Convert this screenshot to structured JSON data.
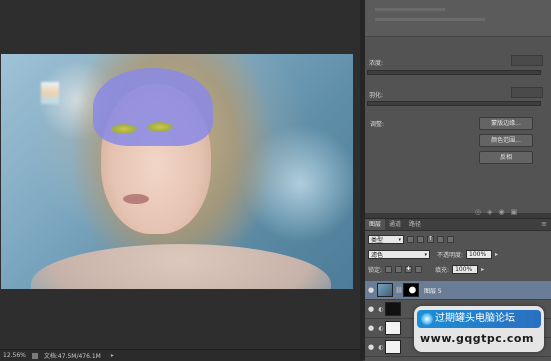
{
  "status_bar": {
    "zoom": "12.56%",
    "doc_info": "文档:47.5M/476.1M"
  },
  "properties": {
    "density_label": "浓度:",
    "feather_label": "羽化:",
    "adjust_label": "调整:",
    "buttons": [
      "蒙版边缘...",
      "颜色范围...",
      "反相"
    ]
  },
  "layers_panel": {
    "tabs": [
      "图层",
      "通道",
      "路径"
    ],
    "kind_filter": "类型",
    "blend_mode": "滤色",
    "opacity_label": "不透明度:",
    "opacity_value": "100%",
    "lock_label": "锁定:",
    "fill_label": "填充:",
    "fill_value": "100%",
    "layers": [
      {
        "name": "图层 5",
        "selected": true
      },
      {
        "name": "",
        "selected": false
      },
      {
        "name": "",
        "selected": false
      },
      {
        "name": "",
        "selected": false
      }
    ]
  },
  "watermark": {
    "title": "过期罐头电脑论坛",
    "url": "www.gqgtpc.com"
  },
  "icons": {
    "eye": "eye-icon",
    "chain": "link-icon",
    "menu": "panel-menu-icon"
  }
}
